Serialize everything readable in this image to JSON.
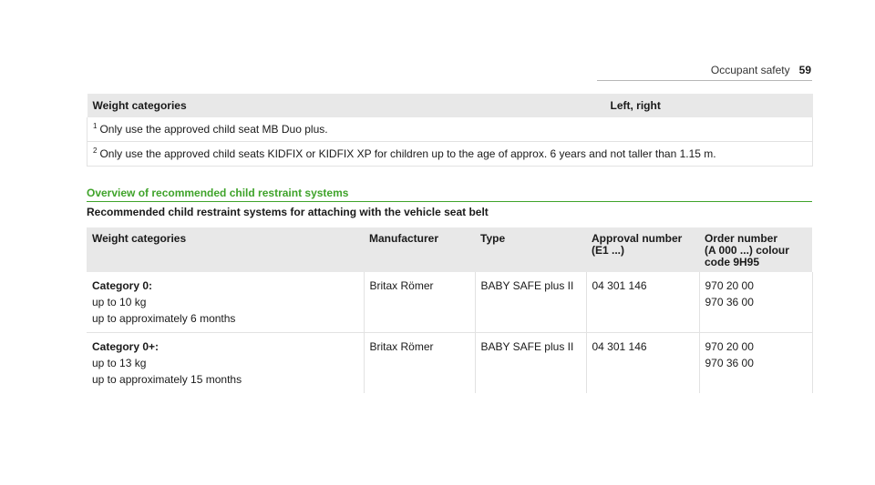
{
  "header": {
    "section": "Occupant safety",
    "page_number": "59"
  },
  "weight_table": {
    "headers": [
      "Weight categories",
      "Left, right"
    ],
    "footnotes": [
      {
        "num": "1",
        "text": "Only use the approved child seat MB Duo plus."
      },
      {
        "num": "2",
        "text": "Only use the approved child seats KIDFIX or KIDFIX XP for children up to the age of approx. 6 years and not taller than 1.15 m."
      }
    ]
  },
  "section": {
    "title": "Overview of recommended child restraint systems",
    "subtitle": "Recommended child restraint systems for attaching with the vehicle seat belt"
  },
  "restraint_table": {
    "headers": {
      "weight": "Weight categories",
      "manufacturer": "Manufacturer",
      "type": "Type",
      "approval_line1": "Approval number",
      "approval_line2": "(E1 ...)",
      "order_line1": "Order number",
      "order_line2": "(A 000 ...) colour",
      "order_line3": "code 9H95"
    },
    "rows": [
      {
        "category": "Category 0:",
        "weight": "up to 10 kg",
        "age": "up to approximately 6 months",
        "manufacturer": "Britax Römer",
        "type": "BABY SAFE plus II",
        "approval": "04 301 146",
        "order1": "970 20 00",
        "order2": "970 36 00"
      },
      {
        "category": "Category 0+:",
        "weight": "up to 13 kg",
        "age": "up to approximately 15 months",
        "manufacturer": "Britax Römer",
        "type": "BABY SAFE plus II",
        "approval": "04 301 146",
        "order1": "970 20 00",
        "order2": "970 36 00"
      }
    ]
  }
}
